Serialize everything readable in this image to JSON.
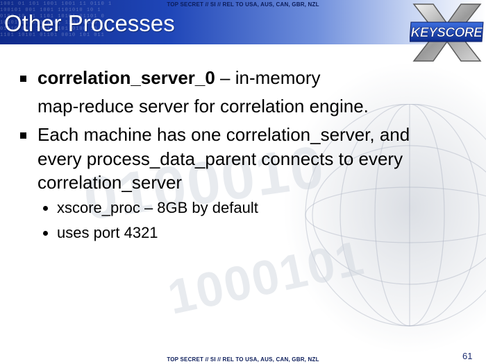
{
  "classification": "TOP SECRET // SI // REL TO USA, AUS, CAN, GBR, NZL",
  "title": "Other Processes",
  "logo_text": "KEYSCORE",
  "bullets": [
    {
      "bold": "correlation_server_0",
      "text_line1": " – in-memory",
      "text_line2": "map-reduce server for correlation engine."
    },
    {
      "lines": [
        "Each machine has one correlation_server, and",
        "every process_data_parent connects to every",
        "correlation_server"
      ],
      "sub_bullets": [
        "xscore_proc – 8GB by default",
        "uses port 4321"
      ]
    }
  ],
  "page_number": "61",
  "colors": {
    "header_dark": "#0f2a8a",
    "header_light": "#c9d6f3",
    "classification_text": "#0b1c5a"
  }
}
